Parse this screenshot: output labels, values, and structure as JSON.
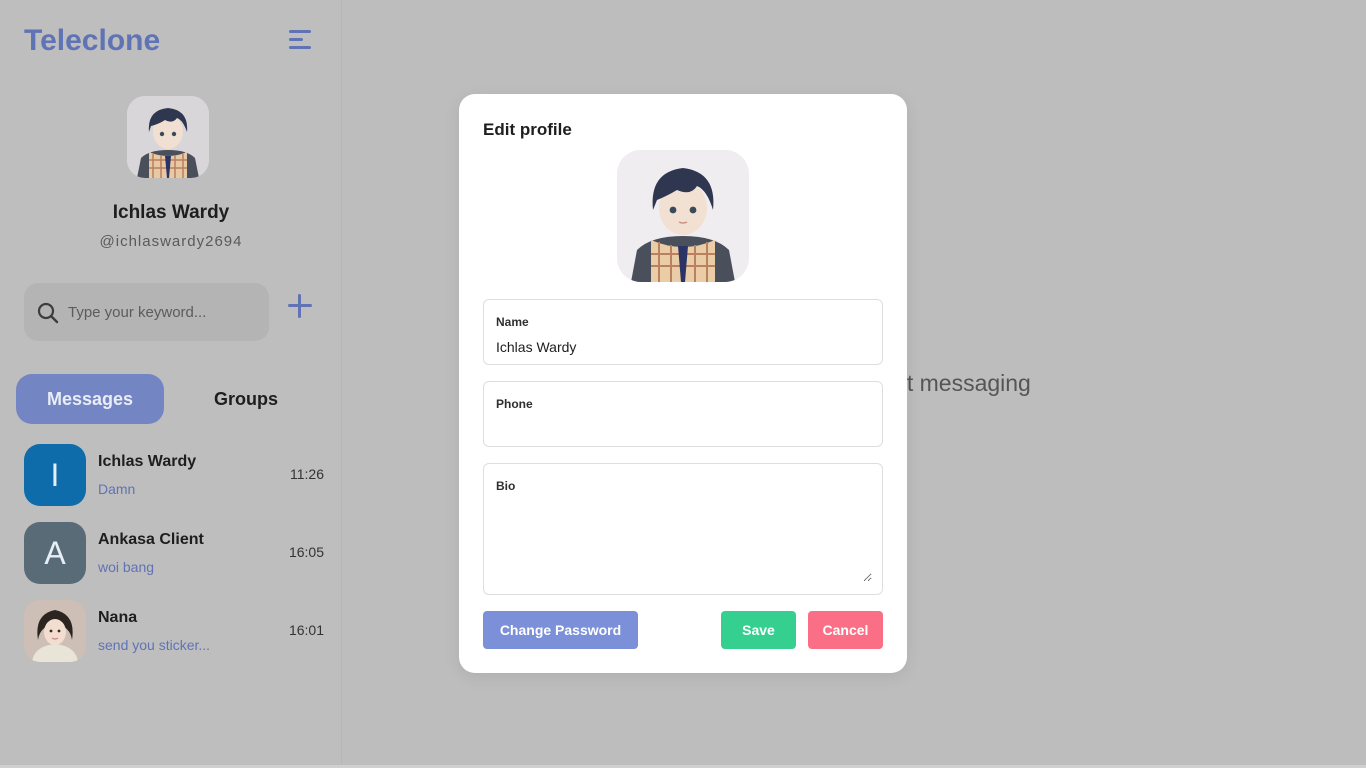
{
  "app": {
    "title": "Teleclone"
  },
  "profile": {
    "name": "Ichlas Wardy",
    "handle": "@ichlaswardy2694"
  },
  "search": {
    "placeholder": "Type your keyword..."
  },
  "tabs": {
    "messages": "Messages",
    "groups": "Groups"
  },
  "chats": [
    {
      "initial": "I",
      "name": "Ichlas Wardy",
      "last_message": "Damn",
      "time": "11:26",
      "color": "#0f6cab"
    },
    {
      "initial": "A",
      "name": "Ankasa Client",
      "last_message": "woi bang",
      "time": "16:05",
      "color": "#5a6b78"
    },
    {
      "initial": "",
      "name": "Nana",
      "last_message": "send you sticker...",
      "time": "16:01",
      "color": "#c9b9ae"
    }
  ],
  "main": {
    "empty_text": "tart messaging"
  },
  "modal": {
    "title": "Edit profile",
    "name_label": "Name",
    "name_value": "Ichlas Wardy",
    "phone_label": "Phone",
    "phone_value": "",
    "bio_label": "Bio",
    "bio_value": "",
    "change_password": "Change Password",
    "save": "Save",
    "cancel": "Cancel"
  },
  "colors": {
    "accent": "#5f73b5",
    "save": "#35d08f",
    "cancel": "#fb6f86",
    "change_password": "#7b90d9"
  }
}
